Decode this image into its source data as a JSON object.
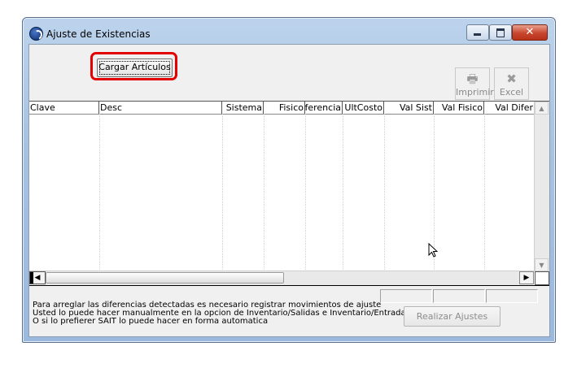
{
  "window": {
    "title": "Ajuste de Existencias",
    "accent_close": "#c8452d"
  },
  "toolbar": {
    "cargar_label": "Cargar Artículos",
    "imprimir_label": "Imprimir",
    "excel_label": "Excel",
    "highlight_color": "#e30000"
  },
  "grid": {
    "columns": [
      "Clave",
      "Desc",
      "Sistema",
      "Fisico",
      "Diferencia",
      "UltCosto",
      "Val Sist",
      "Val Fisico",
      "Val Difer"
    ],
    "rows": []
  },
  "footer": {
    "notes": [
      "Para arreglar las diferencias detectadas es necesario registrar movimientos de ajuste",
      "Usted lo puede hacer manualmente en la opcion de Inventario/Salidas e Inventario/Entradas",
      "O si lo prefierer SAIT lo puede hacer en forma automatica"
    ],
    "realizar_label": "Realizar Ajustes",
    "totals": [
      "",
      "",
      ""
    ]
  }
}
